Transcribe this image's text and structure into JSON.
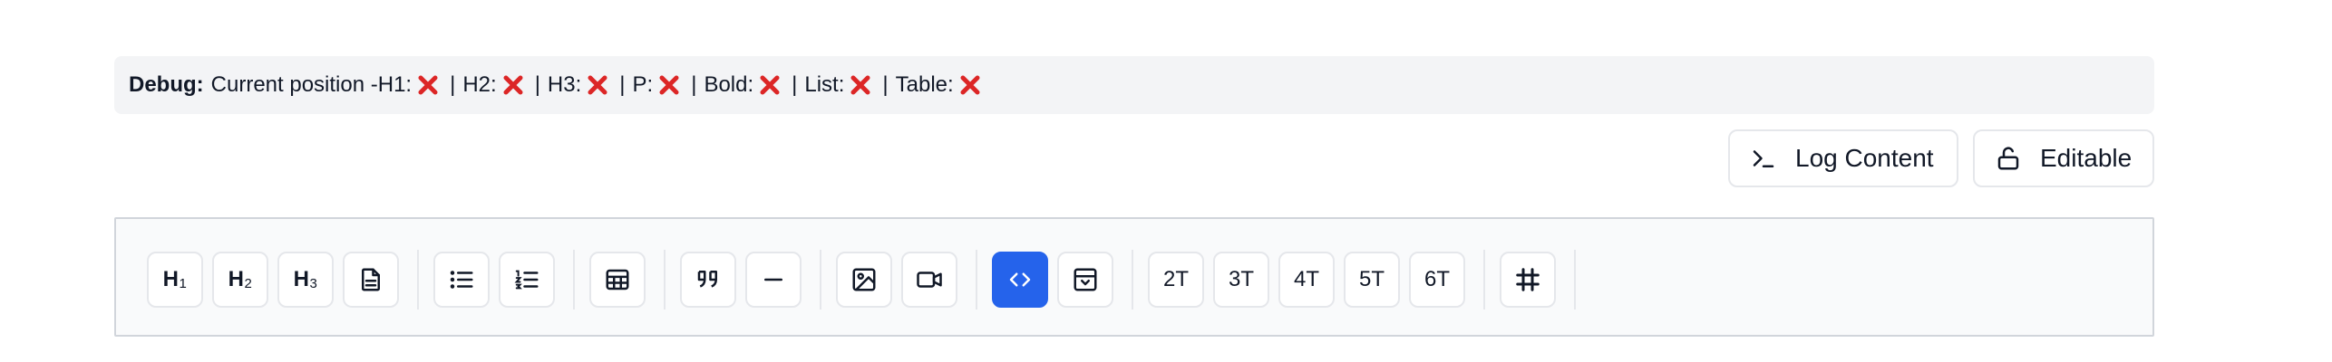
{
  "debug": {
    "label": "Debug:",
    "prefix": "Current position - ",
    "items": [
      {
        "label": "H1:",
        "status": "x-mark"
      },
      {
        "label": "H2:",
        "status": "x-mark"
      },
      {
        "label": "H3:",
        "status": "x-mark"
      },
      {
        "label": "P:",
        "status": "x-mark"
      },
      {
        "label": "Bold:",
        "status": "x-mark"
      },
      {
        "label": "List:",
        "status": "x-mark"
      },
      {
        "label": "Table:",
        "status": "x-mark"
      }
    ],
    "separator": "|"
  },
  "actions": {
    "log_content": "Log Content",
    "editable": "Editable"
  },
  "toolbar": {
    "heading1": {
      "main": "H",
      "sub": "1"
    },
    "heading2": {
      "main": "H",
      "sub": "2"
    },
    "heading3": {
      "main": "H",
      "sub": "3"
    },
    "columns": [
      "2T",
      "3T",
      "4T",
      "5T",
      "6T"
    ]
  },
  "colors": {
    "accent": "#2563eb",
    "x_mark": "#dc2626"
  }
}
